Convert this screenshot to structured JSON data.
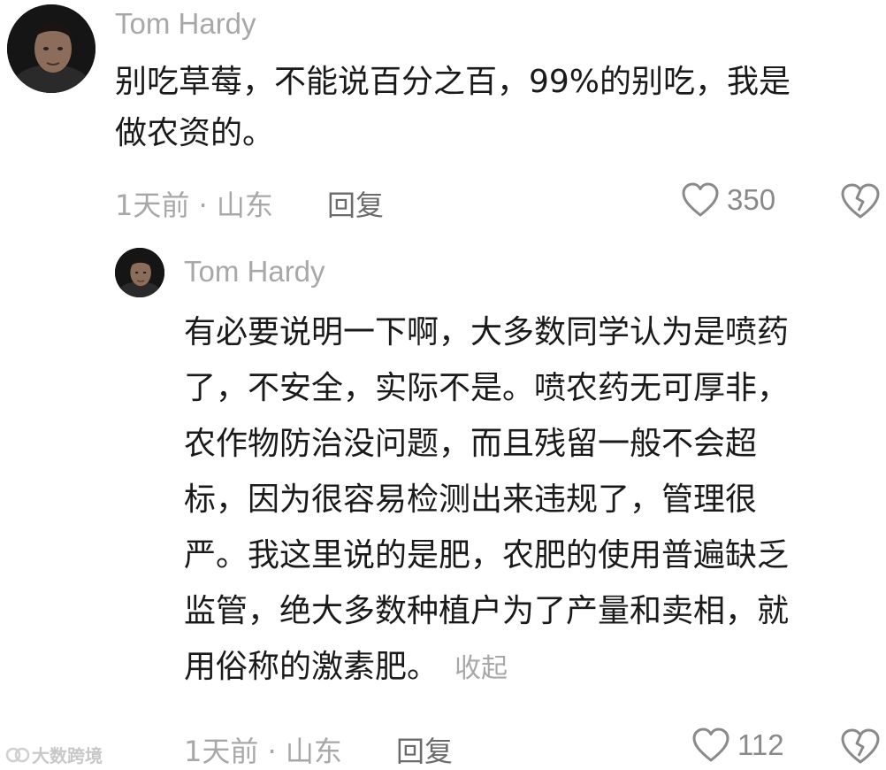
{
  "comment": {
    "username": "Tom Hardy",
    "text_lines": [
      "别吃草莓，不能说百分之百，99%的别吃，我是",
      "做农资的。"
    ],
    "time_location": "1天前 · 山东",
    "reply_label": "回复",
    "likes": "350",
    "icons": {
      "like": "heart-outline-icon",
      "dislike": "broken-heart-icon"
    }
  },
  "reply": {
    "username": "Tom Hardy",
    "text_lines": [
      "有必要说明一下啊，大多数同学认为是喷药",
      "了，不安全，实际不是。喷农药无可厚非，",
      "农作物防治没问题，而且残留一般不会超",
      "标，因为很容易检测出来违规了，管理很",
      "严。我这里说的是肥，农肥的使用普遍缺乏",
      "监管，绝大多数种植户为了产量和卖相，就",
      "用俗称的激素肥。"
    ],
    "collapse_label": "收起",
    "time_location": "1天前 · 山东",
    "reply_label": "回复",
    "likes": "112",
    "icons": {
      "like": "heart-outline-icon",
      "dislike": "broken-heart-icon"
    }
  },
  "watermark": {
    "text": "大数跨境"
  },
  "colors": {
    "text": "#1a1a1a",
    "muted": "#a8a8a8",
    "reply_button": "#6b6b6b"
  }
}
